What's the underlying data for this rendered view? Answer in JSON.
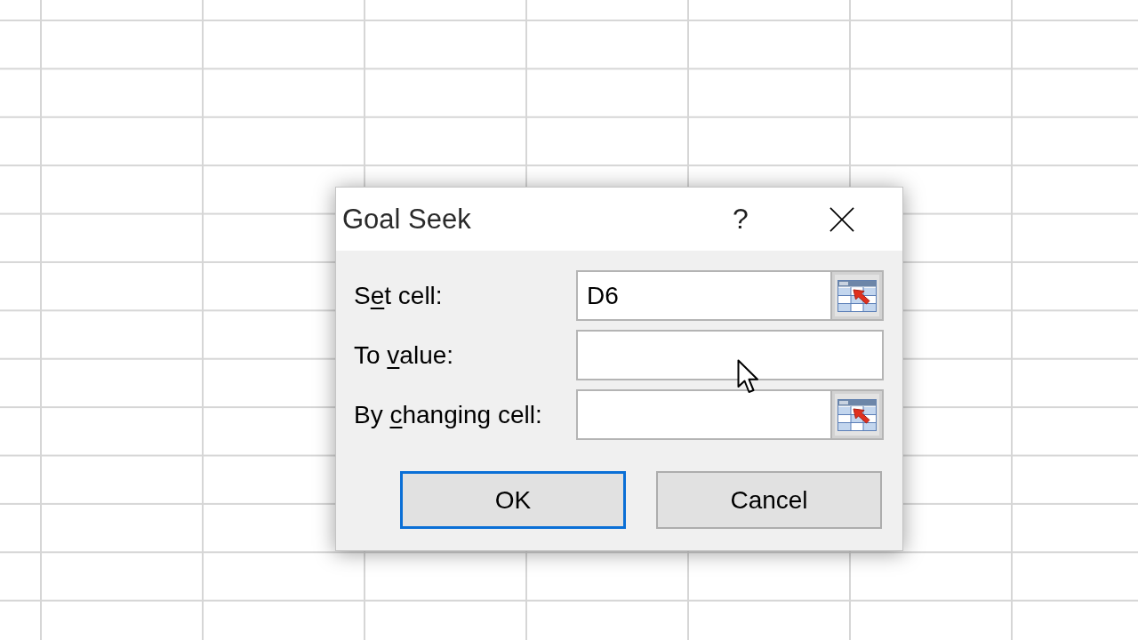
{
  "window": {
    "title": "Goal Seek",
    "help_button": "?"
  },
  "fields": [
    {
      "label": [
        {
          "text": "S",
          "underlined": false
        },
        {
          "text": "e",
          "underlined": true
        },
        {
          "text": "t cell:",
          "underlined": false
        }
      ],
      "value": "D6",
      "range_picker": true
    },
    {
      "label": [
        {
          "text": "To ",
          "underlined": false
        },
        {
          "text": "v",
          "underlined": true
        },
        {
          "text": "alue:",
          "underlined": false
        }
      ],
      "range_picker": false
    },
    {
      "label": [
        {
          "text": "By ",
          "underlined": false
        },
        {
          "text": "c",
          "underlined": true
        },
        {
          "text": "hanging cell:",
          "underlined": false
        }
      ],
      "range_picker": true
    }
  ],
  "buttons": [
    {
      "label": "OK",
      "default": true
    },
    {
      "label": "Cancel",
      "default": false
    }
  ]
}
